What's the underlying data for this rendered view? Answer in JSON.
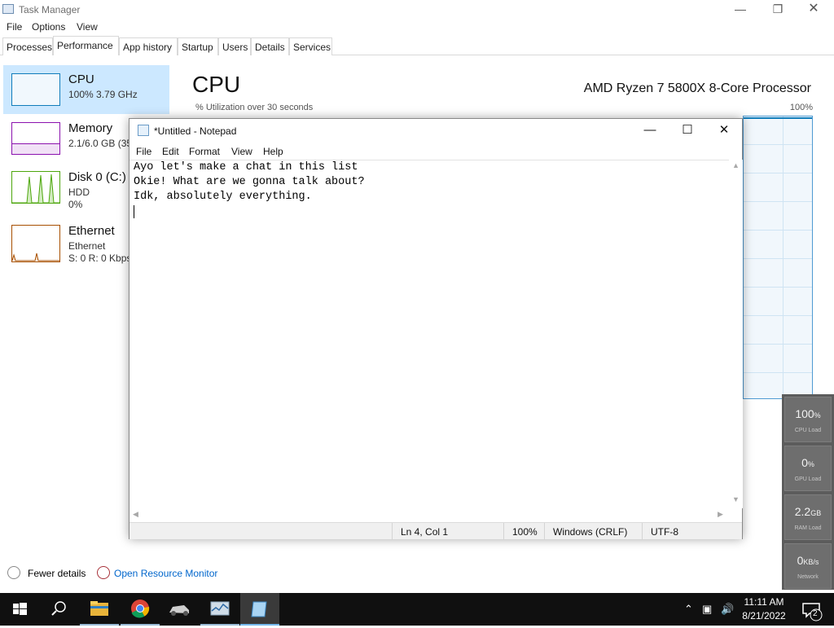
{
  "task_manager": {
    "title": "Task Manager",
    "menu": [
      "File",
      "Options",
      "View"
    ],
    "tabs": [
      "Processes",
      "Performance",
      "App history",
      "Startup",
      "Users",
      "Details",
      "Services"
    ],
    "active_tab": "Performance",
    "sidebar": [
      {
        "name": "CPU",
        "line1": "100% 3.79 GHz",
        "line2": ""
      },
      {
        "name": "Memory",
        "line1": "2.1/6.0 GB (35",
        "line2": ""
      },
      {
        "name": "Disk 0 (C:)",
        "line1": "HDD",
        "line2": "0%"
      },
      {
        "name": "Ethernet",
        "line1": "Ethernet",
        "line2": "S: 0 R: 0 Kbps"
      }
    ],
    "main_title": "CPU",
    "cpu_model": "AMD Ryzen 7 5800X 8-Core Processor",
    "util_label": "% Utilization over 30 seconds",
    "util_max": "100%",
    "footer": {
      "fewer_details": "Fewer details",
      "open_monitor": "Open Resource Monitor"
    },
    "colors": {
      "cpu": "#117dbb",
      "memory": "#8b12ae",
      "disk": "#4da60c",
      "ethernet": "#a74f01",
      "selected": "#cce8ff"
    }
  },
  "widget": [
    {
      "value": "100",
      "unit": "%",
      "label": "CPU Load"
    },
    {
      "value": "0",
      "unit": "%",
      "label": "GPU Load"
    },
    {
      "value": "2.2",
      "unit": "GB",
      "label": "RAM Load"
    },
    {
      "value": "0",
      "unit": "KB/s",
      "label": "Network"
    }
  ],
  "notepad": {
    "title": "*Untitled - Notepad",
    "menu": [
      "File",
      "Edit",
      "Format",
      "View",
      "Help"
    ],
    "lines": [
      "Ayo let's make a chat in this list",
      "Okie! What are we gonna talk about?",
      "Idk, absolutely everything."
    ],
    "status": {
      "position": "Ln 4, Col 1",
      "zoom": "100%",
      "line_endings": "Windows (CRLF)",
      "encoding": "UTF-8"
    }
  },
  "taskbar": {
    "icons": [
      "windows-start-icon",
      "search-icon",
      "file-explorer-icon",
      "chrome-icon",
      "car-game-icon",
      "task-manager-icon",
      "notepad-icon"
    ],
    "time": "11:11 AM",
    "date": "8/21/2022",
    "notification_count": "2"
  }
}
